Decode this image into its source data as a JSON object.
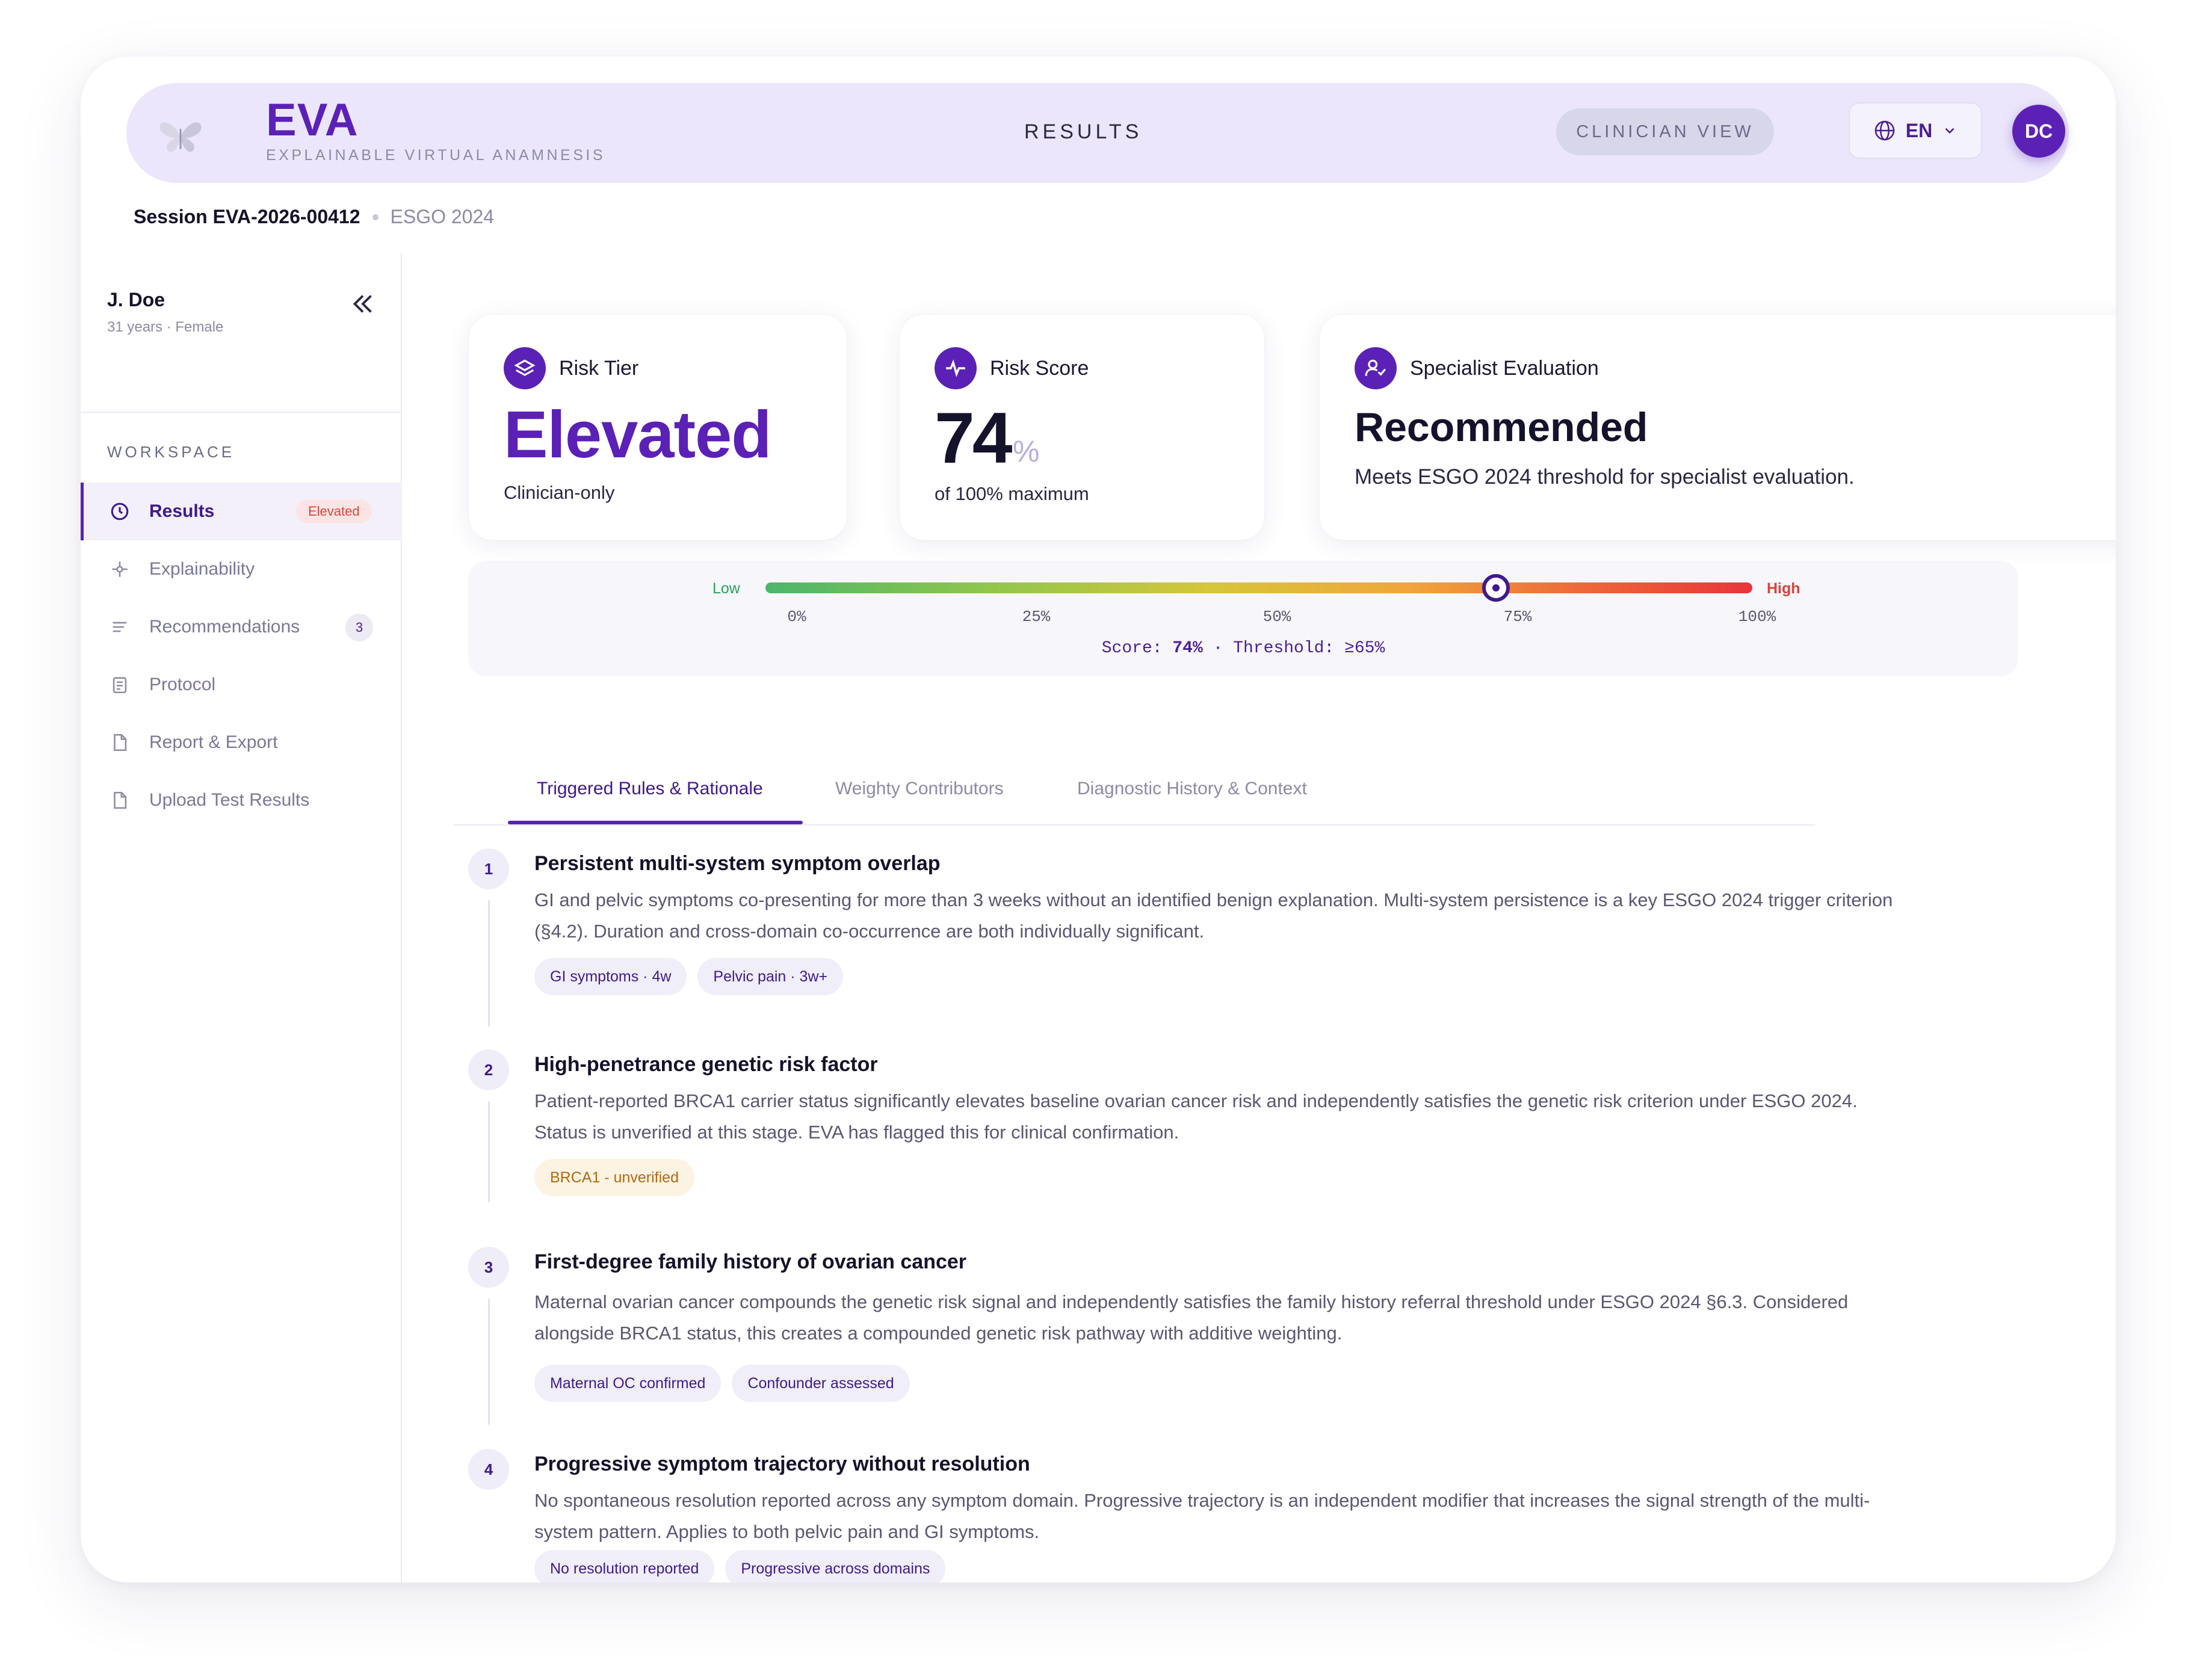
{
  "header": {
    "brand": "EVA",
    "brand_sub": "EXPLAINABLE VIRTUAL ANAMNESIS",
    "page_title": "RESULTS",
    "clinician_view_label": "CLINICIAN VIEW",
    "language": "EN",
    "avatar_initials": "DC"
  },
  "session": {
    "id": "Session EVA-2026-00412",
    "guideline": "ESGO 2024"
  },
  "patient": {
    "name": "J. Doe",
    "meta": "31 years · Female"
  },
  "sidebar": {
    "section_label": "WORKSPACE",
    "items": [
      {
        "label": "Results",
        "icon": "clock-icon",
        "badge": "Elevated"
      },
      {
        "label": "Explainability",
        "icon": "sparkle-icon"
      },
      {
        "label": "Recommendations",
        "icon": "lines-icon",
        "badge": "3"
      },
      {
        "label": "Protocol",
        "icon": "clipboard-icon"
      },
      {
        "label": "Report & Export",
        "icon": "document-icon"
      },
      {
        "label": "Upload Test Results",
        "icon": "document-icon"
      }
    ]
  },
  "cards": {
    "risk_tier": {
      "label": "Risk Tier",
      "value": "Elevated",
      "sub": "Clinician-only",
      "icon": "layers-icon"
    },
    "risk_score": {
      "label": "Risk Score",
      "value": "74",
      "unit": "%",
      "sub": "of 100% maximum",
      "icon": "pulse-icon"
    },
    "specialist": {
      "label": "Specialist Evaluation",
      "value": "Recommended",
      "sub": "Meets ESGO 2024 threshold for specialist evaluation.",
      "icon": "user-check-icon"
    }
  },
  "gauge": {
    "low_label": "Low",
    "high_label": "High",
    "score_fraction": 0.74,
    "ticks": [
      "0%",
      "25%",
      "50%",
      "75%",
      "100%"
    ],
    "summary_prefix": "Score: ",
    "summary_score": "74%",
    "summary_suffix": " · Threshold: ≥65%",
    "colors": {
      "low": "#4cb66a",
      "mid": "#d6c63a",
      "high": "#e8353a"
    }
  },
  "tabs": [
    {
      "label": "Triggered Rules & Rationale",
      "active": true
    },
    {
      "label": "Weighty Contributors",
      "active": false
    },
    {
      "label": "Diagnostic History & Context",
      "active": false
    }
  ],
  "rules": [
    {
      "num": "1",
      "title": "Persistent multi-system symptom overlap",
      "body": "GI and pelvic symptoms co-presenting for more than 3 weeks without an identified benign explanation. Multi-system persistence is a key ESGO 2024 trigger criterion (§4.2). Duration and cross-domain co-occurrence are both individually significant.",
      "chips": [
        {
          "label": "GI symptoms · 4w",
          "tone": "default"
        },
        {
          "label": "Pelvic pain · 3w+",
          "tone": "default"
        }
      ]
    },
    {
      "num": "2",
      "title": "High-penetrance genetic risk factor",
      "body": "Patient-reported BRCA1 carrier status significantly elevates baseline ovarian cancer risk and independently satisfies the genetic risk criterion under ESGO 2024. Status is unverified at this stage. EVA has flagged this for clinical confirmation.",
      "chips": [
        {
          "label": "BRCA1 - unverified",
          "tone": "warn"
        }
      ]
    },
    {
      "num": "3",
      "title": "First-degree family history of ovarian cancer",
      "body": "Maternal ovarian cancer compounds the genetic risk signal and independently satisfies the family history referral threshold under ESGO 2024 §6.3. Considered alongside BRCA1 status, this creates a compounded genetic risk pathway with additive weighting.",
      "chips": [
        {
          "label": "Maternal OC confirmed",
          "tone": "default"
        },
        {
          "label": "Confounder assessed",
          "tone": "default"
        }
      ]
    },
    {
      "num": "4",
      "title": "Progressive symptom trajectory without resolution",
      "body": "No spontaneous resolution reported across any symptom domain. Progressive trajectory is an independent modifier that increases the signal strength of the multi-system pattern. Applies to both pelvic pain and GI symptoms.",
      "chips": [
        {
          "label": "No resolution reported",
          "tone": "default"
        },
        {
          "label": "Progressive across domains",
          "tone": "default"
        }
      ]
    }
  ]
}
